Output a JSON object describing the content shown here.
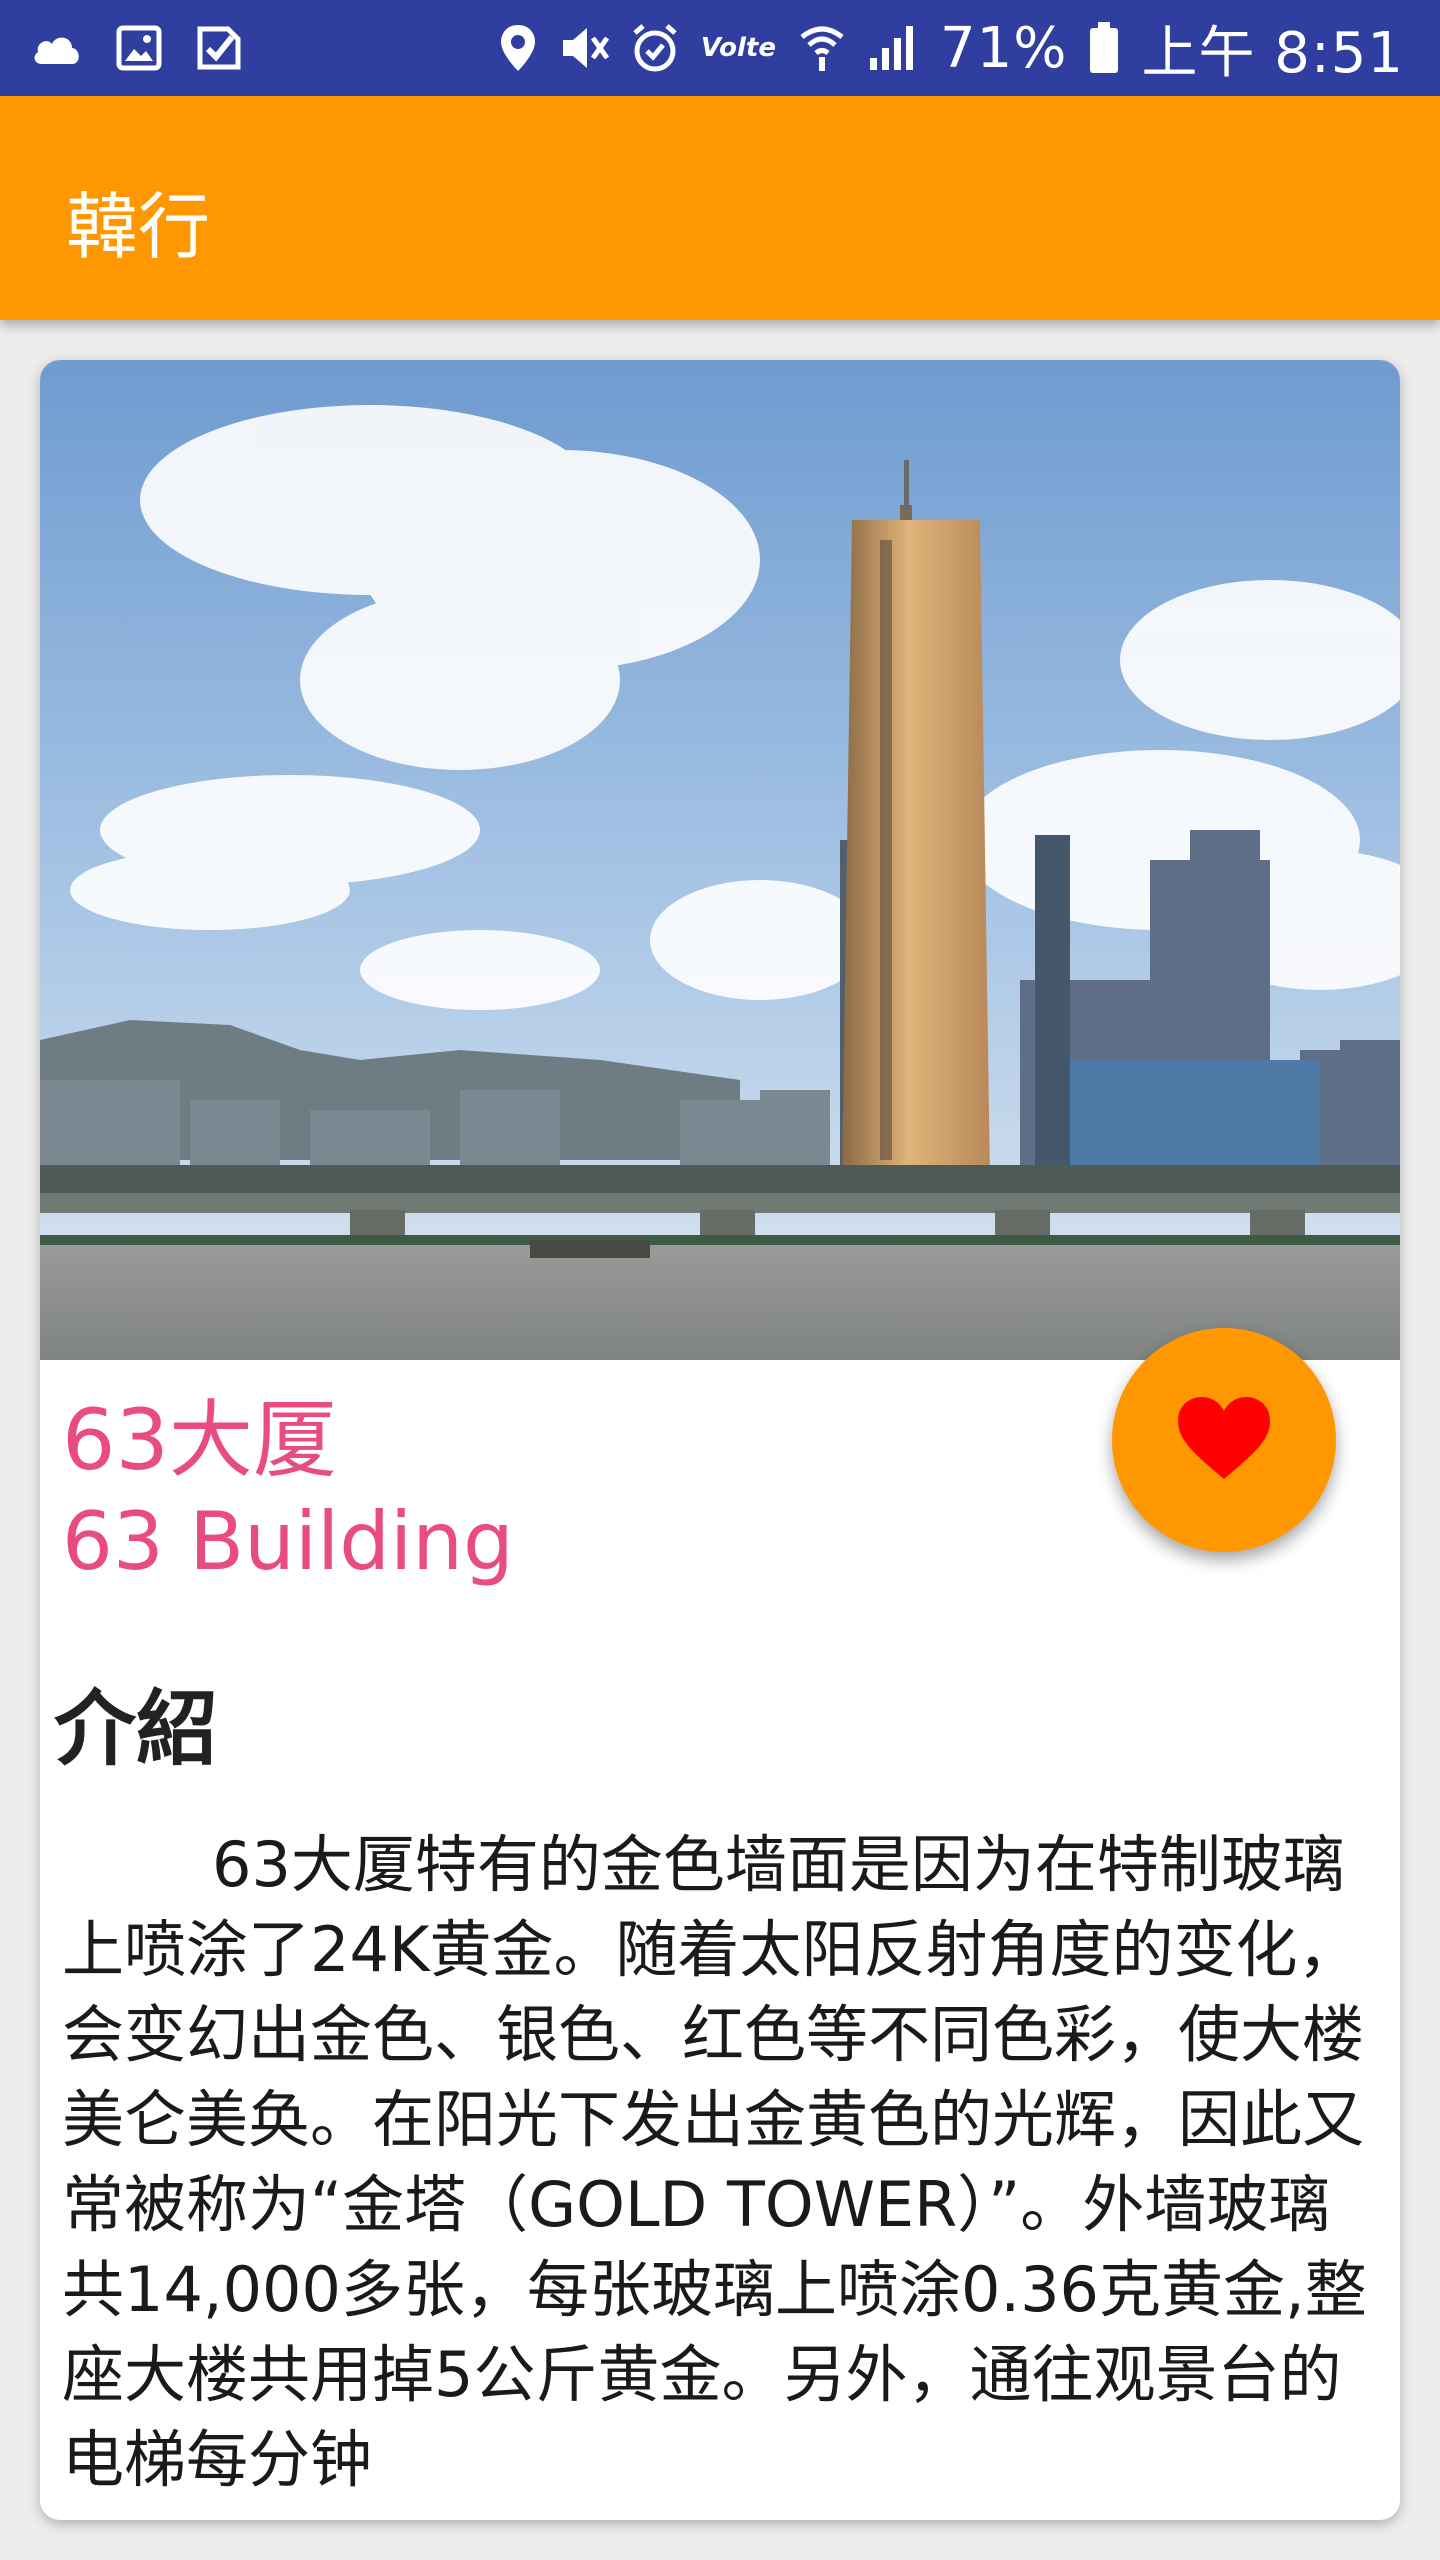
{
  "status_bar": {
    "lte_label": "Volte",
    "battery": "71%",
    "time": "上午 8:51",
    "left_icons": [
      "cloud-icon",
      "image-icon",
      "check-badge-icon"
    ],
    "right_icons": [
      "location-icon",
      "mute-icon",
      "alarm-icon",
      "volte-icon",
      "wifi-icon",
      "signal-icon",
      "battery-icon"
    ]
  },
  "app_bar": {
    "title": "韓行"
  },
  "attraction": {
    "name_zh": "63大厦",
    "name_en": "63 Building",
    "favorite_icon": "heart-icon",
    "colors": {
      "name": "#e84c83",
      "fab": "#ff9800",
      "heart": "#ff0000"
    }
  },
  "intro": {
    "heading": "介紹",
    "body": "63大厦特有的金色墙面是因为在特制玻璃上喷涂了24K黄金。随着太阳反射角度的变化，会变幻出金色、银色、红色等不同色彩，使大楼美仑美奂。在阳光下发出金黄色的光辉，因此又常被称为“金塔（GOLD TOWER）”。外墙玻璃共14,000多张，每张玻璃上喷涂0.36克黄金,整座大楼共用掉5公斤黄金。另外，通往观景台的电梯每分钟"
  },
  "theme": {
    "primary_dark": "#303f9f",
    "primary": "#ff9800",
    "accent": "#e84c83"
  }
}
